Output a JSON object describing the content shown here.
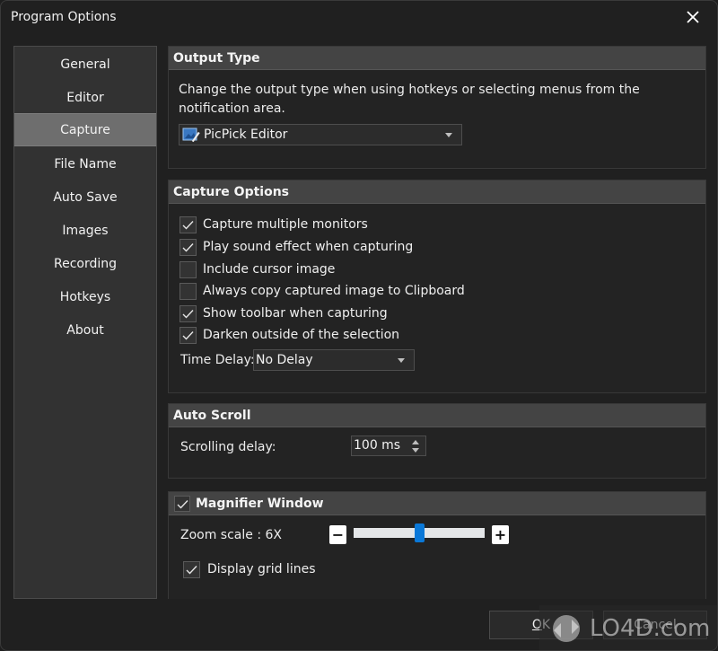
{
  "window": {
    "title": "Program Options"
  },
  "sidebar": {
    "items": [
      {
        "label": "General",
        "active": false
      },
      {
        "label": "Editor",
        "active": false
      },
      {
        "label": "Capture",
        "active": true
      },
      {
        "label": "File Name",
        "active": false
      },
      {
        "label": "Auto Save",
        "active": false
      },
      {
        "label": "Images",
        "active": false
      },
      {
        "label": "Recording",
        "active": false
      },
      {
        "label": "Hotkeys",
        "active": false
      },
      {
        "label": "About",
        "active": false
      }
    ]
  },
  "output_type": {
    "header": "Output Type",
    "description": "Change the output type when using hotkeys or selecting menus from the notification area.",
    "selected": "PicPick Editor",
    "icon": "picpick-editor-icon"
  },
  "capture_options": {
    "header": "Capture Options",
    "options": [
      {
        "label": "Capture multiple monitors",
        "checked": true
      },
      {
        "label": "Play sound effect when capturing",
        "checked": true
      },
      {
        "label": "Include cursor image",
        "checked": false
      },
      {
        "label": "Always copy captured image to Clipboard",
        "checked": false
      },
      {
        "label": "Show toolbar when capturing",
        "checked": true
      },
      {
        "label": "Darken outside of the selection",
        "checked": true
      }
    ],
    "time_delay_label": "Time Delay:",
    "time_delay_value": "No Delay"
  },
  "auto_scroll": {
    "header": "Auto Scroll",
    "scrolling_delay_label": "Scrolling delay:",
    "scrolling_delay_value": "100 ms"
  },
  "magnifier": {
    "header": "Magnifier Window",
    "enabled": true,
    "zoom_scale_label": "Zoom scale : 6X",
    "zoom_level_fraction": 0.5,
    "minus_label": "−",
    "plus_label": "+",
    "display_grid_label": "Display grid lines",
    "display_grid_checked": true
  },
  "footer": {
    "ok_mnemonic": "O",
    "ok_rest": "K",
    "cancel_label": "Cancel"
  },
  "watermark": {
    "text": "LO4D.com"
  }
}
